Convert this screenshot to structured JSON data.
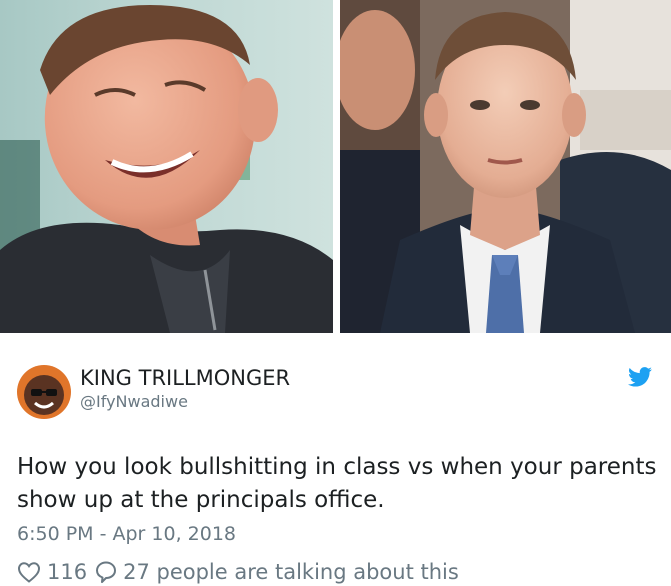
{
  "images": [
    {
      "name": "left-photo",
      "description": "laughing"
    },
    {
      "name": "right-photo",
      "description": "serious"
    }
  ],
  "author": {
    "display_name": "KING TRILLMONGER",
    "handle": "@IfyNwadiwe"
  },
  "tweet": {
    "text": "How you look bullshitting in class vs when your parents show up at the principals office.",
    "timestamp": "6:50 PM - Apr 10, 2018"
  },
  "actions": {
    "like_count": "116",
    "replies_text": "27 people are talking about this"
  },
  "icons": {
    "like": "heart-icon",
    "reply": "speech-bubble-icon",
    "brand": "twitter-bird-icon"
  },
  "colors": {
    "text": "#1c2022",
    "secondary": "#697882",
    "twitter_blue": "#1da1f2"
  }
}
